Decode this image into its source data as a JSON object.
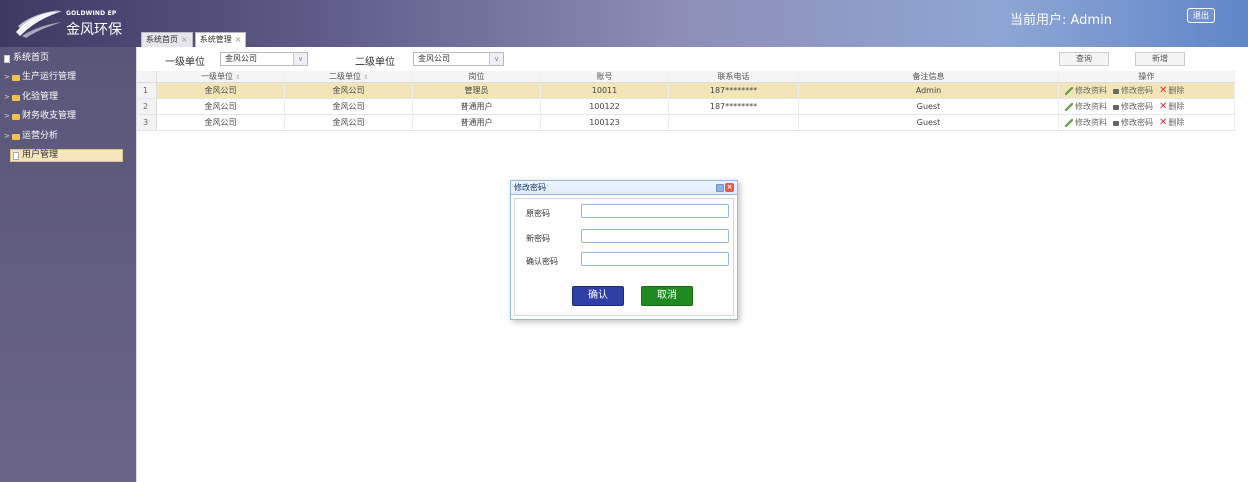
{
  "header": {
    "logo_en": "GOLDWIND EP",
    "logo_cn": "金风环保",
    "current_user": "当前用户: Admin",
    "logout_label": "退出",
    "tabs": [
      {
        "label": "系统首页",
        "close": "×"
      },
      {
        "label": "系统管理",
        "close": "×"
      }
    ]
  },
  "sidebar": {
    "items": [
      {
        "label": "系统首页",
        "icon": "doc-icon"
      },
      {
        "label": "生产运行管理",
        "icon": "folder-icon",
        "arrow": ">"
      },
      {
        "label": "化验管理",
        "icon": "folder-icon",
        "arrow": ">"
      },
      {
        "label": "财务收支管理",
        "icon": "folder-icon",
        "arrow": ">"
      },
      {
        "label": "运营分析",
        "icon": "folder-icon",
        "arrow": ">"
      },
      {
        "label": "用户管理",
        "icon": "doc-icon",
        "active": true
      }
    ]
  },
  "filter": {
    "level1_label": "一级单位",
    "level1_value": "金风公司",
    "level2_label": "二级单位",
    "level2_value": "金风公司",
    "dropdown_glyph": "∨",
    "query_label": "查询",
    "add_label": "新增"
  },
  "table": {
    "headers": [
      "一级单位",
      "二级单位",
      "岗位",
      "账号",
      "联系电话",
      "备注信息",
      "操作"
    ],
    "sort_glyph": "⇕",
    "rows": [
      {
        "no": "1",
        "unit1": "金风公司",
        "unit2": "金风公司",
        "post": "管理员",
        "account": "10011",
        "phone": "187********",
        "note": "Admin"
      },
      {
        "no": "2",
        "unit1": "金风公司",
        "unit2": "金风公司",
        "post": "普通用户",
        "account": "100122",
        "phone": "187********",
        "note": "Guest"
      },
      {
        "no": "3",
        "unit1": "金风公司",
        "unit2": "金风公司",
        "post": "普通用户",
        "account": "100123",
        "phone": "",
        "note": "Guest"
      }
    ],
    "ops": {
      "edit": "修改资料",
      "password": "修改密码",
      "delete": "删除"
    }
  },
  "dialog": {
    "title": "修改密码",
    "old_label": "原密码",
    "new_label": "新密码",
    "confirm_label": "确认密码",
    "ok_label": "确认",
    "cancel_label": "取消",
    "close_glyph": "×"
  },
  "colors": {
    "selected_row": "#f4e5b8",
    "ok_button": "#2f3fa6",
    "cancel_button": "#1f8a1f",
    "dialog_border": "#95b8e7"
  }
}
